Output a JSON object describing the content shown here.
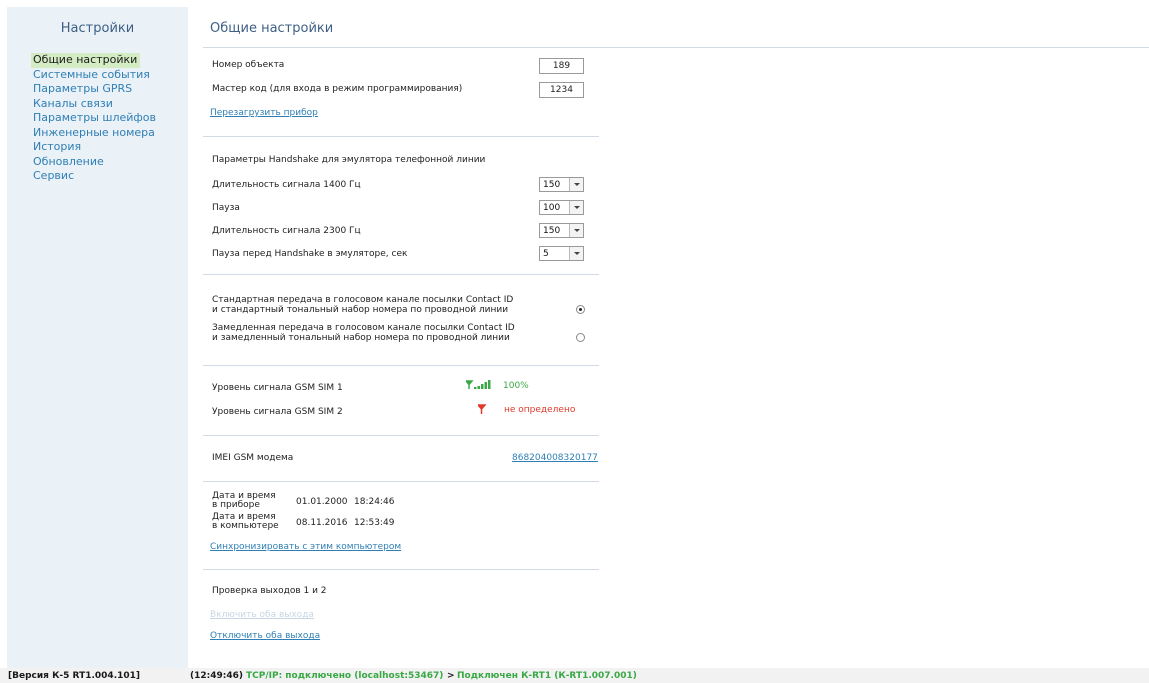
{
  "sidebar": {
    "title": "Настройки",
    "items": [
      {
        "label": "Общие настройки"
      },
      {
        "label": "Системные события"
      },
      {
        "label": "Параметры GPRS"
      },
      {
        "label": "Каналы связи"
      },
      {
        "label": "Параметры шлейфов"
      },
      {
        "label": "Инженерные номера"
      },
      {
        "label": "История"
      },
      {
        "label": "Обновление"
      },
      {
        "label": "Сервис"
      }
    ]
  },
  "main": {
    "title": "Общие настройки",
    "object_number": {
      "label": "Номер объекта",
      "value": "189"
    },
    "master_code": {
      "label": "Мастер код (для входа в режим программирования)",
      "value": "1234"
    },
    "reboot_link": "Перезагрузить прибор",
    "handshake": {
      "heading": "Параметры Handshake для эмулятора телефонной линии",
      "signal_1400": {
        "label": "Длительность сигнала 1400 Гц",
        "value": "150"
      },
      "pause": {
        "label": "Пауза",
        "value": "100"
      },
      "signal_2300": {
        "label": "Длительность сигнала 2300 Гц",
        "value": "150"
      },
      "pause_before": {
        "label": "Пауза перед Handshake в эмуляторе, сек",
        "value": "5"
      }
    },
    "transmission": {
      "standard_line1": "Стандартная передача в голосовом канале посылки Contact ID",
      "standard_line2": "и стандартный тональный набор номера по проводной линии",
      "slow_line1": "Замедленная передача в голосовом канале посылки Contact ID",
      "slow_line2": "и замедленный тональный набор номера по проводной линии",
      "selected": "standard"
    },
    "gsm": {
      "sim1_label": "Уровень сигнала GSM SIM 1",
      "sim1_value": "100%",
      "sim2_label": "Уровень сигнала GSM SIM 2",
      "sim2_value": "не определено",
      "good_color": "#3aa845",
      "bad_color": "#e03a2c"
    },
    "imei": {
      "label": "IMEI GSM модема",
      "value": "868204008320177"
    },
    "datetime": {
      "device_label_1": "Дата и время",
      "device_label_2": "в приборе",
      "device_date": "01.01.2000",
      "device_time": "18:24:46",
      "pc_label_1": "Дата и время",
      "pc_label_2": "в компьютере",
      "pc_date": "08.11.2016",
      "pc_time": "12:53:49",
      "sync_link": "Синхронизировать с этим компьютером"
    },
    "outputs": {
      "heading": "Проверка выходов 1 и 2",
      "enable_link": "Включить оба выхода",
      "disable_link": "Отключить оба выхода"
    }
  },
  "statusbar": {
    "version": "[Версия К-5 RT1.004.101]",
    "time": "(12:49:46)",
    "connection": "TCP/IP: подключено (localhost:53467)",
    "arrow": ">",
    "device": "Подключен К-RT1 (К-RT1.007.001)",
    "ok_color": "#3aa845"
  }
}
